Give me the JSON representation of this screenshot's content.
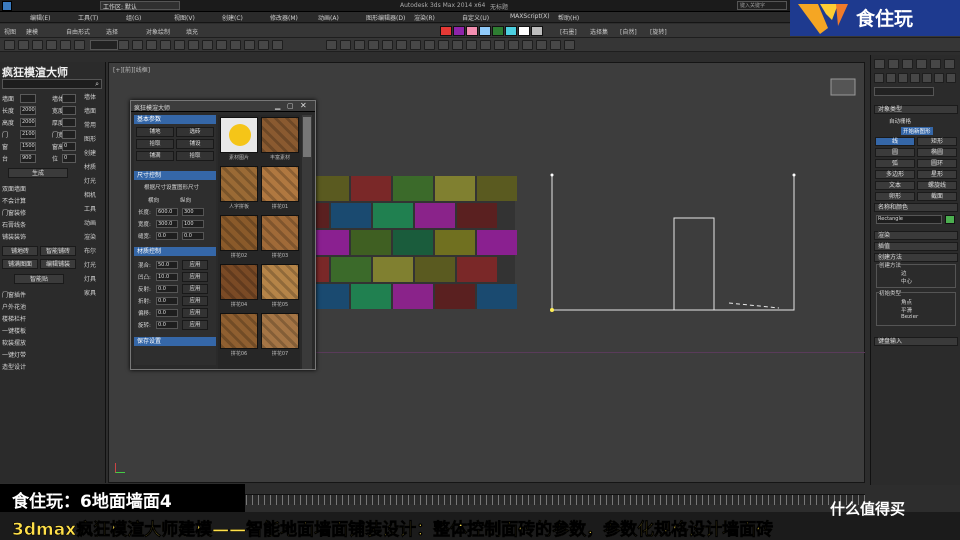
{
  "window_title": "Autodesk 3ds Max 2014 x64",
  "window_file": "无标题",
  "workspace": "工作区: 默认",
  "search_placeholder": "键入关键字",
  "menubar": [
    "编辑(E)",
    "工具(T)",
    "组(G)",
    "视图(V)",
    "创建(C)",
    "修改器(M)",
    "动画(A)",
    "图形编辑器(D)",
    "渲染(R)",
    "自定义(U)",
    "MAXScript(X)",
    "帮助(H)"
  ],
  "toolbar_view": "视图",
  "toolbar_tabs": [
    "建模",
    "自由形式",
    "选择",
    "对象绘制",
    "填充"
  ],
  "toolbar_right": [
    "[石墨]",
    "选择集",
    "[自然]",
    "[旋转]"
  ],
  "toolbar_swatch_colors": [
    "#e53935",
    "#8e24aa",
    "#f48fb1",
    "#90caf9",
    "#2e7d32",
    "#4dd0e1",
    "#ffffff",
    "#bdbdbd"
  ],
  "brand": {
    "name": "食住玩",
    "color": "#1e3a8f"
  },
  "left_panel": {
    "title": "疯狂模渲大师",
    "rows": [
      {
        "label": "墙面",
        "value1": "",
        "unit": "",
        "label2": "墙体",
        "value2": ""
      },
      {
        "label": "长度",
        "value1": "2000",
        "unit": "",
        "label2": "宽度",
        "value2": ""
      },
      {
        "label": "高度",
        "value1": "2000",
        "unit": "",
        "label2": "厚度",
        "value2": ""
      },
      {
        "label": "门",
        "value1": "2100",
        "unit": "",
        "label2": "门宽",
        "value2": ""
      },
      {
        "label": "窗",
        "value1": "1500",
        "unit": "",
        "label2": "窗高",
        "value2": "0"
      },
      {
        "label": "台",
        "value1": "900",
        "unit": "",
        "label2": "位",
        "value2": "0"
      }
    ],
    "center_button": "生成",
    "side_items": [
      "墙体",
      "墙面",
      "常用",
      "图形",
      "创建",
      "材质",
      "灯光",
      "相机",
      "工具",
      "动画",
      "渲染",
      "布尔",
      "灯光",
      "灯具",
      "家具"
    ],
    "sections": [
      {
        "label": "双面墙面"
      },
      {
        "label": "不会计算"
      },
      {
        "label": "门窗装修"
      },
      {
        "label": "石膏线条"
      },
      {
        "label": "铺装装饰"
      }
    ],
    "buttons": [
      "铺地砖",
      "智能铺砖",
      "铺满图面",
      "编辑铺装"
    ],
    "button_center": "智能贴",
    "more_sections": [
      "门窗插件",
      "户外花池",
      "楼梯栏杆",
      "一键楼板",
      "软装摆放",
      "一键灯带",
      "造型设计"
    ]
  },
  "dialog": {
    "title": "疯狂模渲大师",
    "sec1": "基本参数",
    "btns1": [
      "铺地",
      "选砖",
      "拾取",
      "铺设",
      "铺满",
      "拾取"
    ],
    "sec2": "尺寸控制",
    "check1": "根据尺寸设置图形尺寸",
    "lbl_h": "横向",
    "lbl_v": "纵向",
    "params": [
      {
        "label": "长度:",
        "v1": "600.0",
        "v2": "300"
      },
      {
        "label": "宽度:",
        "v1": "300.0",
        "v2": "100"
      },
      {
        "label": "缝宽:",
        "v1": "0.0",
        "v2": "0.0"
      }
    ],
    "sec3": "材质控制",
    "params2": [
      {
        "label": "混合:",
        "v1": "50.0",
        "btn": "应用"
      },
      {
        "label": "凹凸:",
        "v1": "10.0",
        "btn": "应用"
      },
      {
        "label": "反射:",
        "v1": "0.0",
        "btn": "应用"
      },
      {
        "label": "折射:",
        "v1": "0.0",
        "btn": "应用"
      },
      {
        "label": "偏移:",
        "v1": "0.0",
        "btn": "应用"
      },
      {
        "label": "旋转:",
        "v1": "0.0",
        "btn": "应用"
      }
    ],
    "sec4": "保存设置",
    "thumb_captions": [
      "素材图片",
      "丰富素材",
      "人字拼板",
      "拼花01",
      "拼花02",
      "拼花03",
      "拼花04",
      "拼花05",
      "拼花06",
      "拼花07"
    ]
  },
  "command_panel": {
    "object_type": "对象类型",
    "autogrid": "自动栅格",
    "start_new": "开始新图形",
    "shapes": [
      "线",
      "矩形",
      "圆",
      "椭圆",
      "弧",
      "圆环",
      "多边形",
      "星形",
      "文本",
      "螺旋线",
      "卵形",
      "截面"
    ],
    "name_color": "名称和颜色",
    "name_value": "Rectangle",
    "rollouts": [
      "渲染",
      "插值",
      "创建方法",
      "键盘输入"
    ],
    "radio_label": "创建方法",
    "radios": [
      "边",
      "中心"
    ],
    "radio2_label": "初始类型",
    "radios2": [
      "角点",
      "平滑",
      "Bezier"
    ]
  },
  "caption_episode": "食住玩：6地面墙面4",
  "caption_title": "3dmax疯狂模渲大师建模——智能地面墙面铺装设计：整体控制面砖的参数，参数化规格设计墙面砖",
  "watermark": "什么值得买",
  "tile_colors": [
    "#5a5a20",
    "#3f5f22",
    "#8a238a",
    "#7a2828",
    "#1a5c3c",
    "#5a2020",
    "#3b6a2a",
    "#707020",
    "#1a4a70",
    "#808030",
    "#8a2090",
    "#208050"
  ]
}
